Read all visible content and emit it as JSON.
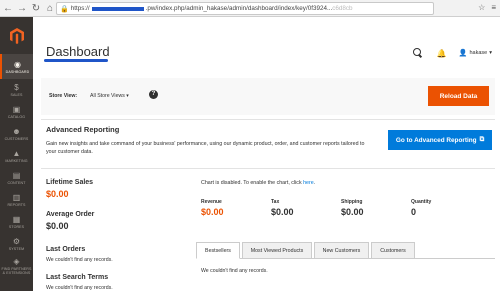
{
  "browser": {
    "back_icon": "arrow-left-icon",
    "forward_icon": "arrow-right-icon",
    "reload_icon": "reload-icon",
    "home_icon": "home-icon",
    "url_prefix": "https://",
    "url_path": ".pw/index.php/admin_hakase/admin/dashboard/index/key/0f3924...",
    "url_tail": "c6d8cb"
  },
  "sidebar": {
    "items": [
      {
        "label": "DASHBOARD",
        "icon": "◉"
      },
      {
        "label": "SALES",
        "icon": "$"
      },
      {
        "label": "CATALOG",
        "icon": "▣"
      },
      {
        "label": "CUSTOMERS",
        "icon": "☻"
      },
      {
        "label": "MARKETING",
        "icon": "▲"
      },
      {
        "label": "CONTENT",
        "icon": "▤"
      },
      {
        "label": "REPORTS",
        "icon": "▥"
      },
      {
        "label": "STORES",
        "icon": "▦"
      },
      {
        "label": "SYSTEM",
        "icon": "⚙"
      },
      {
        "label": "FIND PARTNERS & EXTENSIONS",
        "icon": "◈"
      }
    ]
  },
  "header": {
    "title": "Dashboard",
    "bell_glyph": "🔔",
    "username": "hakase",
    "user_glyph": "👤",
    "caret": "▾"
  },
  "store_bar": {
    "label": "Store View:",
    "selected": "All Store Views ▾",
    "help_glyph": "?",
    "reload_label": "Reload Data"
  },
  "advanced": {
    "title": "Advanced Reporting",
    "text": "Gain new insights and take command of your business' performance, using our dynamic product, order, and customer reports tailored to your customer data.",
    "button_label": "Go to Advanced Reporting",
    "button_glyph": "⧉"
  },
  "stats": {
    "lifetime_label": "Lifetime Sales",
    "lifetime_value": "$0.00",
    "avg_label": "Average Order",
    "avg_value": "$0.00",
    "last_orders_label": "Last Orders",
    "last_orders_empty": "We couldn't find any records.",
    "last_search_label": "Last Search Terms",
    "last_search_empty": "We couldn't find any records."
  },
  "chart": {
    "msg": "Chart is disabled. To enable the chart, click ",
    "link": "here",
    "msg_end": "."
  },
  "metrics": [
    {
      "label": "Revenue",
      "value": "$0.00"
    },
    {
      "label": "Tax",
      "value": "$0.00"
    },
    {
      "label": "Shipping",
      "value": "$0.00"
    },
    {
      "label": "Quantity",
      "value": "0"
    }
  ],
  "tabs": [
    {
      "label": "Bestsellers"
    },
    {
      "label": "Most Viewed Products"
    },
    {
      "label": "New Customers"
    },
    {
      "label": "Customers"
    }
  ],
  "tab_content": "We couldn't find any records.",
  "colors": {
    "accent": "#eb5202",
    "link": "#007bdb",
    "sidebar": "#373330"
  }
}
